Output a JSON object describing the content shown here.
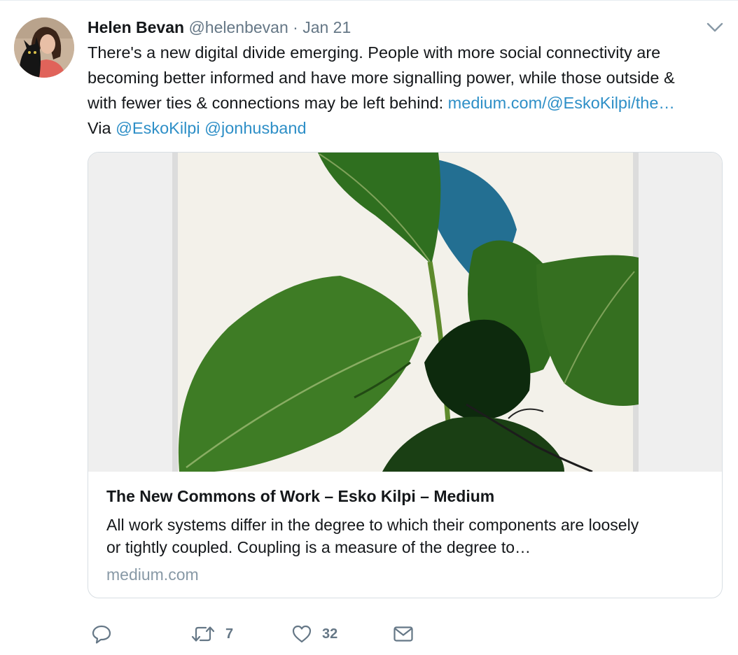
{
  "tweet": {
    "author_name": "Helen Bevan",
    "author_handle": "@helenbevan",
    "separator": "·",
    "date": "Jan 21",
    "text_line1": "There's a new digital divide emerging. People with more social connectivity are",
    "text_line2": "becoming better informed and have more signalling power, while those outside &",
    "text_line3_prefix": "with fewer ties & connections may be left behind: ",
    "url_text": "medium.com/@EskoKilpi/the…",
    "via_prefix": "Via ",
    "mention1": "@EskoKilpi",
    "mention2": "@jonhusband"
  },
  "card": {
    "title": "The New Commons of Work – Esko Kilpi – Medium",
    "description_line1": "All work systems differ in the degree to which their components are loosely",
    "description_line2": "or tightly coupled. Coupling is a measure of the degree to…",
    "domain": "medium.com"
  },
  "actions": {
    "reply_icon": "reply-icon",
    "retweet_icon": "retweet-icon",
    "retweet_count": "7",
    "like_icon": "heart-icon",
    "like_count": "32",
    "message_icon": "envelope-icon"
  },
  "colors": {
    "link": "#2e8fc7",
    "secondary_text": "#657786",
    "domain_text": "#8899a6",
    "card_border": "#d8dee3"
  }
}
